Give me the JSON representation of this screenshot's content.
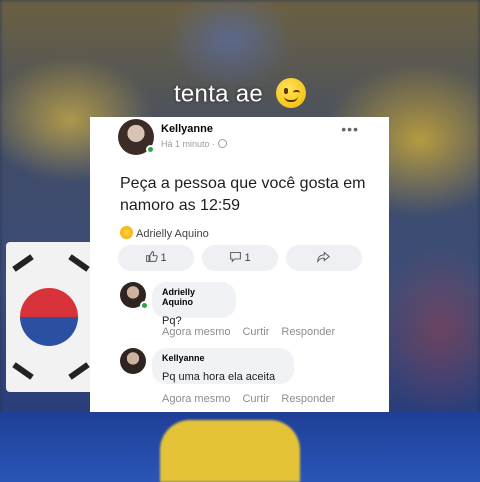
{
  "caption": "tenta ae",
  "post": {
    "author": "Kellyanne",
    "time": "Há 1 minuto ·",
    "body": "Peça a pessoa que você gosta em namoro as 12:59",
    "reactor": "Adrielly Aquino",
    "like_count": "1",
    "comment_count": "1"
  },
  "comments": [
    {
      "author": "Adrielly Aquino",
      "text": "Pq?",
      "time": "Agora mesmo",
      "like_label": "Curtir",
      "reply_label": "Responder"
    },
    {
      "author": "Kellyanne",
      "text": "Pq uma hora ela aceita",
      "time": "Agora mesmo",
      "like_label": "Curtir",
      "reply_label": "Responder"
    }
  ],
  "icons": {
    "caption_emoji": "winking-face-icon",
    "more": "more-options-icon",
    "audience": "globe-icon",
    "reaction": "laughing-face-icon",
    "like": "thumbs-up-icon",
    "comment": "comment-icon",
    "share": "share-icon"
  },
  "colors": {
    "online": "#31a24c",
    "bubble": "#f0f2f5",
    "muted_text": "#8a8d91"
  }
}
